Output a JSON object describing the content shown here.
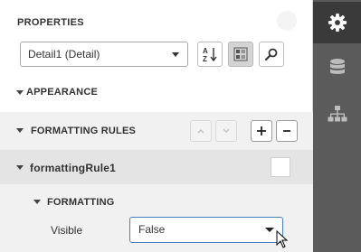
{
  "panel": {
    "title": "PROPERTIES",
    "component_select": {
      "value": "Detail1 (Detail)"
    }
  },
  "toolbar": {
    "sort_icon": "sort-az-icon",
    "categories_icon": "categorized-view-icon",
    "search_icon": "search-icon"
  },
  "sections": {
    "appearance": "APPEARANCE",
    "formatting_rules": "FORMATTING RULES",
    "rule_name": "formattingRule1",
    "formatting": "FORMATTING"
  },
  "property": {
    "label": "Visible",
    "value": "False"
  },
  "tabs": [
    {
      "icon": "gear-icon",
      "active": true
    },
    {
      "icon": "database-icon",
      "active": false
    },
    {
      "icon": "hierarchy-icon",
      "active": false
    }
  ],
  "colors": {
    "tab_bar": "#5b5b5b",
    "tab_active": "#3a3a3a",
    "accent_border": "#4a7fc1"
  }
}
